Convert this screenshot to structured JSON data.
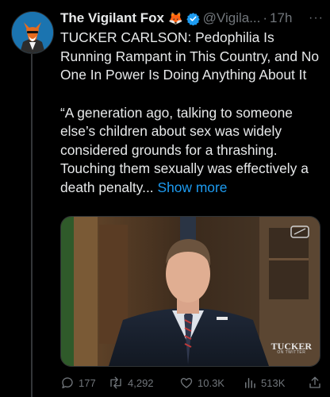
{
  "tweet": {
    "display_name": "The Vigilant Fox",
    "name_emoji": "🦊",
    "handle": "@Vigila...",
    "separator": "·",
    "time": "17h",
    "more": "···",
    "text_headline": "TUCKER CARLSON: Pedophilia Is Running Rampant in This Country, and No One In Power Is Doing Anything About It",
    "text_quote": "“A generation ago, talking to someone else’s children about sex was widely considered grounds for a thrashing. Touching them sexually was effectively a death penalty...",
    "show_more": "Show more",
    "video_watermark": "TUCKER",
    "video_watermark_sub": "ON TWITTER"
  },
  "actions": {
    "replies": "177",
    "retweets": "4,292",
    "likes": "10.3K",
    "views": "513K"
  },
  "colors": {
    "background": "#000000",
    "text": "#e7e9ea",
    "muted": "#71767b",
    "link": "#1d9bf0",
    "verified": "#1d9bf0"
  }
}
